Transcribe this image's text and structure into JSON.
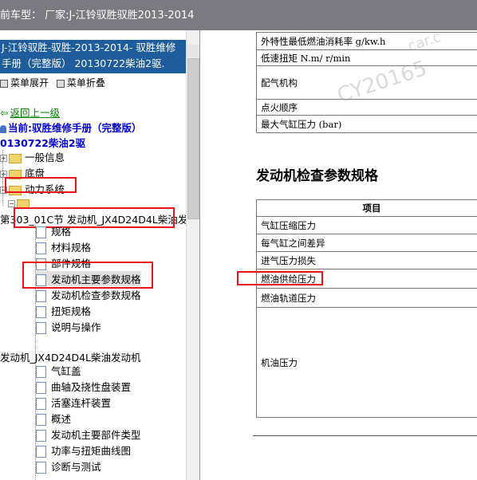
{
  "titlebar": {
    "text": "前车型：  厂家:J-江铃驭胜驭胜2013-2014"
  },
  "left_pane": {
    "manual_title_line1": "J-江铃驭胜-驭胜-2013-2014- 驭胜维修",
    "manual_title_line2": "手册（完整版） 20130722柴油2驱.",
    "menu_expand": "菜单展开",
    "menu_collapse": "菜单折叠",
    "back_link": "返回上一级",
    "current_line1": "当前:驭胜维修手册（完整版）",
    "current_line2": "0130722柴油2驱",
    "tree": [
      "一般信息",
      "底盘",
      "动力系统",
      "",
      "第303_01C节 发动机_JX4D24D4L柴油发",
      "规格",
      "材料规格",
      "部件规格",
      "发动机主要参数规格",
      "发动机检查参数规格",
      "扭矩规格",
      "说明与操作",
      "发动机_JX4D24D4L柴油发动机",
      "气缸盖",
      "曲轴及挠性盘装置",
      "活塞连杆装置",
      "概述",
      "发动机主要部件类型",
      "功率与扭矩曲线图",
      "诊断与测试"
    ]
  },
  "right_pane": {
    "table1_rows": [
      "外特性最低燃油消耗率 g/kw.h",
      "低速扭矩 N.m/ r/min",
      "配气机构",
      "点火顺序",
      "最大气缸压力 (bar)"
    ],
    "section_heading": "发动机检查参数规格",
    "table2_header": "项目",
    "table2_rows": [
      "气缸压缩压力",
      "每气缸之间差异",
      "进气压力损失",
      "燃油供给压力",
      "燃油轨道压力",
      "机油压力"
    ],
    "watermark_main": "CY20165",
    "watermark_small": "car.c"
  },
  "colors": {
    "title_bg": "#1f5c9c",
    "highlight_red": "#e8141c",
    "titlebar_bg": "#7a7a80"
  }
}
